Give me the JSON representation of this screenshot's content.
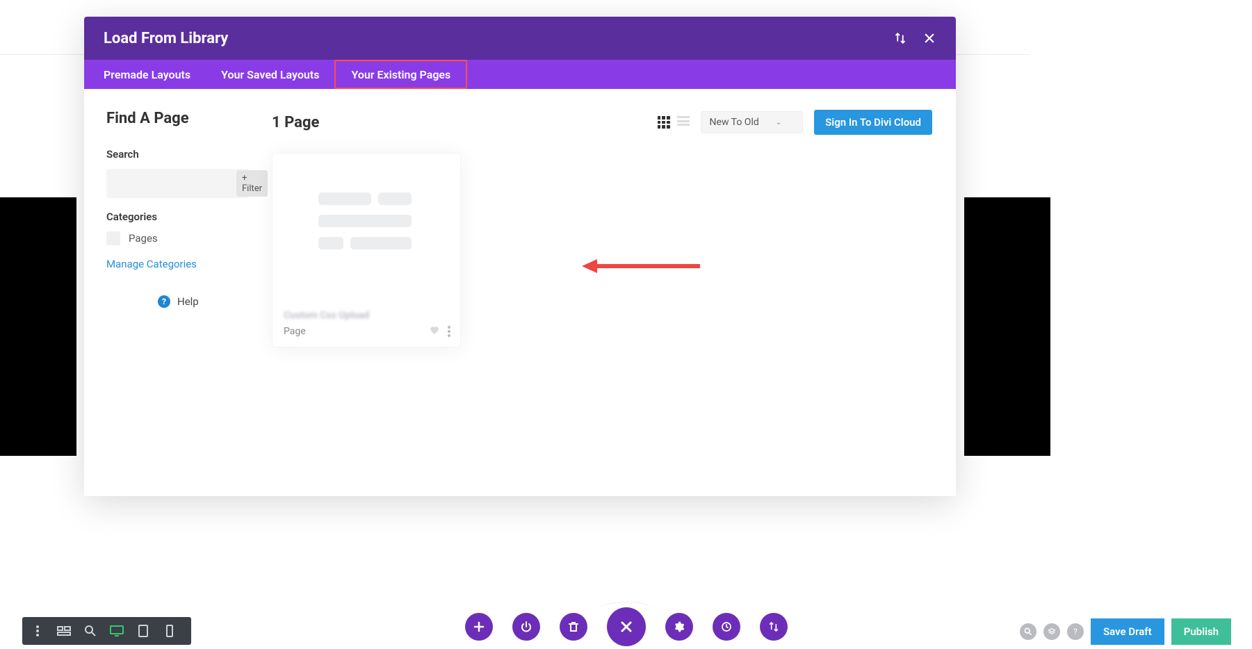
{
  "modal": {
    "title": "Load From Library",
    "tabs": {
      "premade": "Premade Layouts",
      "saved": "Your Saved Layouts",
      "existing": "Your Existing Pages"
    }
  },
  "sidebar": {
    "title": "Find A Page",
    "search_label": "Search",
    "search_placeholder": "",
    "filter_label": "+ Filter",
    "categories_label": "Categories",
    "category_items": [
      "Pages"
    ],
    "manage_link": "Manage Categories",
    "help_label": "Help"
  },
  "main": {
    "count_label": "1 Page",
    "sort_label": "New To Old",
    "signin_label": "Sign In To Divi Cloud",
    "card": {
      "title_blurred": "Custom Css Upload",
      "type_label": "Page"
    }
  },
  "bottom": {
    "save_draft": "Save Draft",
    "publish": "Publish"
  }
}
